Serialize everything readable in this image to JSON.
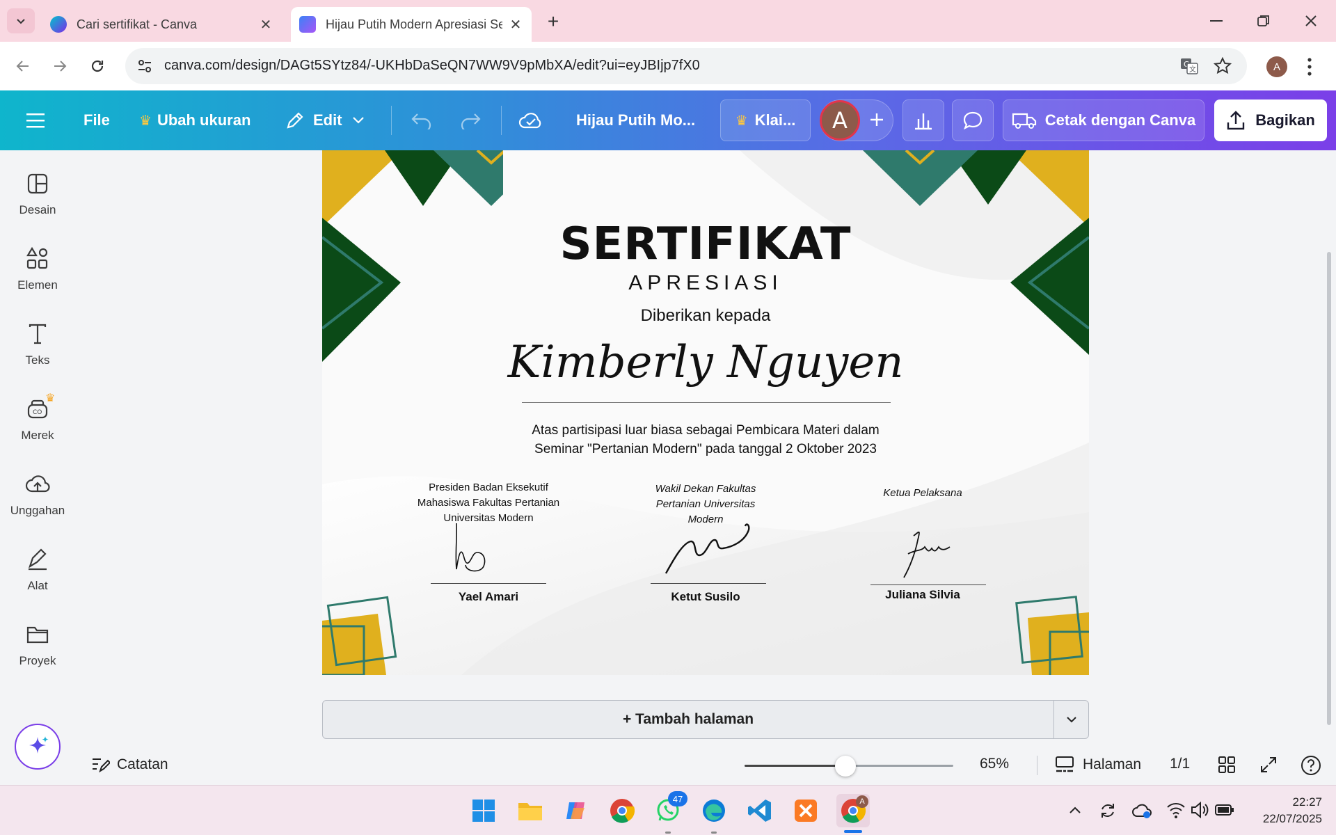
{
  "browser": {
    "tabs": [
      {
        "title": "Cari sertifikat - Canva",
        "active": false
      },
      {
        "title": "Hijau Putih Modern Apresiasi Se",
        "active": true
      }
    ],
    "url": "canva.com/design/DAGt5SYtz84/-UKHbDaSeQN7WW9V9pMbXA/edit?ui=eyJBIjp7fX0",
    "profile_initial": "A"
  },
  "toolbar": {
    "file": "File",
    "resize": "Ubah ukuran",
    "edit": "Edit",
    "doc_title": "Hijau Putih Mo...",
    "claim": "Klai...",
    "avatar": "A",
    "print": "Cetak dengan Canva",
    "share": "Bagikan"
  },
  "sidebar": {
    "items": [
      {
        "label": "Desain",
        "icon": "layout-icon"
      },
      {
        "label": "Elemen",
        "icon": "shapes-icon"
      },
      {
        "label": "Teks",
        "icon": "text-icon"
      },
      {
        "label": "Merek",
        "icon": "brand-icon"
      },
      {
        "label": "Unggahan",
        "icon": "cloud-upload-icon"
      },
      {
        "label": "Alat",
        "icon": "tools-icon"
      },
      {
        "label": "Proyek",
        "icon": "folder-icon"
      }
    ]
  },
  "certificate": {
    "title": "SERTIFIKAT",
    "subtitle": "APRESIASI",
    "given_to": "Diberikan kepada",
    "recipient": "Kimberly Nguyen",
    "description_line1": "Atas partisipasi luar biasa sebagai Pembicara Materi dalam",
    "description_line2": "Seminar \"Pertanian Modern\" pada tanggal 2 Oktober 2023",
    "signers": [
      {
        "role_lines": [
          "Presiden Badan Eksekutif",
          "Mahasiswa Fakultas Pertanian",
          "Universitas Modern"
        ],
        "name": "Yael Amari"
      },
      {
        "role_lines": [
          "Wakil Dekan Fakultas",
          "Pertanian Universitas",
          "Modern"
        ],
        "name": "Ketut Susilo"
      },
      {
        "role_lines": [
          "Ketua Pelaksana"
        ],
        "name": "Juliana Silvia"
      }
    ],
    "colors": {
      "dark_green": "#0b4a17",
      "teal": "#2f7a6c",
      "gold": "#e0b01e"
    }
  },
  "add_page": "+ Tambah halaman",
  "statusbar": {
    "notes": "Catatan",
    "zoom": "65%",
    "zoom_level": 0.4,
    "pages_label": "Halaman",
    "pages": "1/1"
  },
  "taskbar": {
    "time": "22:27",
    "date": "22/07/2025",
    "whatsapp_badge": "47"
  }
}
